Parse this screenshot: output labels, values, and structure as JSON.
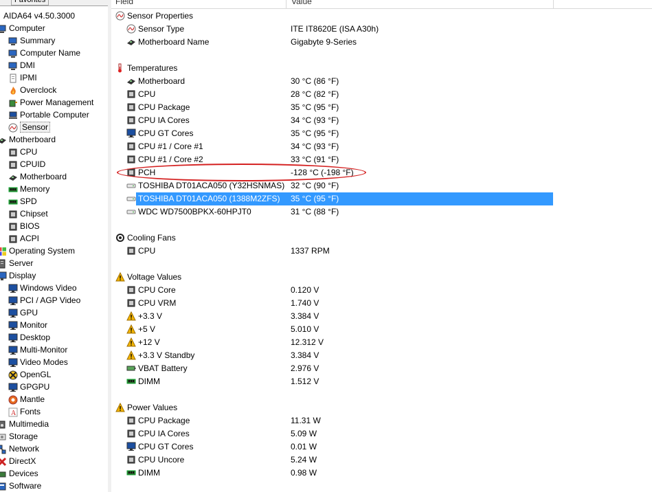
{
  "tabs": {
    "menu": "",
    "favorites": "Favorites"
  },
  "columns": {
    "field": "Field",
    "value": "Value"
  },
  "tree": [
    {
      "label": "AIDA64 v4.50.3000",
      "icon": "aida64-icon",
      "level": 0
    },
    {
      "label": "Computer",
      "icon": "computer-icon",
      "level": 0
    },
    {
      "label": "Summary",
      "icon": "computer-icon",
      "level": 1
    },
    {
      "label": "Computer Name",
      "icon": "computer-icon",
      "level": 1
    },
    {
      "label": "DMI",
      "icon": "computer-icon",
      "level": 1
    },
    {
      "label": "IPMI",
      "icon": "document-icon",
      "level": 1
    },
    {
      "label": "Overclock",
      "icon": "flame-icon",
      "level": 1
    },
    {
      "label": "Power Management",
      "icon": "power-icon",
      "level": 1
    },
    {
      "label": "Portable Computer",
      "icon": "laptop-icon",
      "level": 1
    },
    {
      "label": "Sensor",
      "icon": "sensor-icon",
      "level": 1,
      "selected": true
    },
    {
      "label": "Motherboard",
      "icon": "motherboard-icon",
      "level": 0
    },
    {
      "label": "CPU",
      "icon": "chip-icon",
      "level": 1
    },
    {
      "label": "CPUID",
      "icon": "chip-icon",
      "level": 1
    },
    {
      "label": "Motherboard",
      "icon": "motherboard-icon",
      "level": 1
    },
    {
      "label": "Memory",
      "icon": "memory-icon",
      "level": 1
    },
    {
      "label": "SPD",
      "icon": "memory-icon",
      "level": 1
    },
    {
      "label": "Chipset",
      "icon": "chip-icon",
      "level": 1
    },
    {
      "label": "BIOS",
      "icon": "chip-icon",
      "level": 1
    },
    {
      "label": "ACPI",
      "icon": "chip-icon",
      "level": 1
    },
    {
      "label": "Operating System",
      "icon": "windows-icon",
      "level": 0
    },
    {
      "label": "Server",
      "icon": "server-icon",
      "level": 0
    },
    {
      "label": "Display",
      "icon": "display-icon",
      "level": 0
    },
    {
      "label": "Windows Video",
      "icon": "monitor-icon",
      "level": 1
    },
    {
      "label": "PCI / AGP Video",
      "icon": "monitor-icon",
      "level": 1
    },
    {
      "label": "GPU",
      "icon": "monitor-icon",
      "level": 1
    },
    {
      "label": "Monitor",
      "icon": "monitor-icon",
      "level": 1
    },
    {
      "label": "Desktop",
      "icon": "monitor-icon",
      "level": 1
    },
    {
      "label": "Multi-Monitor",
      "icon": "monitor-icon",
      "level": 1
    },
    {
      "label": "Video Modes",
      "icon": "monitor-icon",
      "level": 1
    },
    {
      "label": "OpenGL",
      "icon": "opengl-icon",
      "level": 1
    },
    {
      "label": "GPGPU",
      "icon": "monitor-icon",
      "level": 1
    },
    {
      "label": "Mantle",
      "icon": "mantle-icon",
      "level": 1
    },
    {
      "label": "Fonts",
      "icon": "font-icon",
      "level": 1
    },
    {
      "label": "Multimedia",
      "icon": "multimedia-icon",
      "level": 0
    },
    {
      "label": "Storage",
      "icon": "storage-icon",
      "level": 0
    },
    {
      "label": "Network",
      "icon": "network-icon",
      "level": 0
    },
    {
      "label": "DirectX",
      "icon": "directx-icon",
      "level": 0
    },
    {
      "label": "Devices",
      "icon": "devices-icon",
      "level": 0
    },
    {
      "label": "Software",
      "icon": "software-icon",
      "level": 0
    }
  ],
  "rows": [
    {
      "type": "group",
      "field": "Sensor Properties",
      "value": "",
      "icon": "sensor-icon"
    },
    {
      "type": "item",
      "field": "Sensor Type",
      "value": "ITE IT8620E  (ISA A30h)",
      "icon": "sensor-icon"
    },
    {
      "type": "item",
      "field": "Motherboard Name",
      "value": "Gigabyte 9-Series",
      "icon": "motherboard-icon"
    },
    {
      "type": "spacer"
    },
    {
      "type": "group",
      "field": "Temperatures",
      "value": "",
      "icon": "thermometer-icon"
    },
    {
      "type": "item",
      "field": "Motherboard",
      "value": "30 °C  (86 °F)",
      "icon": "motherboard-icon"
    },
    {
      "type": "item",
      "field": "CPU",
      "value": "28 °C  (82 °F)",
      "icon": "chip-icon"
    },
    {
      "type": "item",
      "field": "CPU Package",
      "value": "35 °C  (95 °F)",
      "icon": "chip-icon"
    },
    {
      "type": "item",
      "field": "CPU IA Cores",
      "value": "34 °C  (93 °F)",
      "icon": "chip-icon"
    },
    {
      "type": "item",
      "field": "CPU GT Cores",
      "value": "35 °C  (95 °F)",
      "icon": "monitor-icon"
    },
    {
      "type": "item",
      "field": "CPU #1 / Core #1",
      "value": "34 °C  (93 °F)",
      "icon": "chip-icon"
    },
    {
      "type": "item",
      "field": "CPU #1 / Core #2",
      "value": "33 °C  (91 °F)",
      "icon": "chip-icon"
    },
    {
      "type": "item",
      "field": "PCH",
      "value": "-128 °C  (-198 °F)",
      "icon": "chip-icon",
      "circled": true
    },
    {
      "type": "item",
      "field": "TOSHIBA DT01ACA050 (Y32HSNMAS)",
      "value": "32 °C  (90 °F)",
      "icon": "hdd-icon"
    },
    {
      "type": "item",
      "field": "TOSHIBA DT01ACA050 (1388M2ZFS)",
      "value": "35 °C  (95 °F)",
      "icon": "hdd-icon",
      "highlighted": true
    },
    {
      "type": "item",
      "field": "WDC WD7500BPKX-60HPJT0",
      "value": "31 °C  (88 °F)",
      "icon": "hdd-icon"
    },
    {
      "type": "spacer"
    },
    {
      "type": "group",
      "field": "Cooling Fans",
      "value": "",
      "icon": "fan-icon"
    },
    {
      "type": "item",
      "field": "CPU",
      "value": "1337 RPM",
      "icon": "chip-icon"
    },
    {
      "type": "spacer"
    },
    {
      "type": "group",
      "field": "Voltage Values",
      "value": "",
      "icon": "warning-icon"
    },
    {
      "type": "item",
      "field": "CPU Core",
      "value": "0.120 V",
      "icon": "chip-icon"
    },
    {
      "type": "item",
      "field": "CPU VRM",
      "value": "1.740 V",
      "icon": "chip-icon"
    },
    {
      "type": "item",
      "field": "+3.3 V",
      "value": "3.384 V",
      "icon": "warning-icon"
    },
    {
      "type": "item",
      "field": "+5 V",
      "value": "5.010 V",
      "icon": "warning-icon"
    },
    {
      "type": "item",
      "field": "+12 V",
      "value": "12.312 V",
      "icon": "warning-icon"
    },
    {
      "type": "item",
      "field": "+3.3 V Standby",
      "value": "3.384 V",
      "icon": "warning-icon"
    },
    {
      "type": "item",
      "field": "VBAT Battery",
      "value": "2.976 V",
      "icon": "battery-icon"
    },
    {
      "type": "item",
      "field": "DIMM",
      "value": "1.512 V",
      "icon": "memory-icon"
    },
    {
      "type": "spacer"
    },
    {
      "type": "group",
      "field": "Power Values",
      "value": "",
      "icon": "warning-icon"
    },
    {
      "type": "item",
      "field": "CPU Package",
      "value": "11.31 W",
      "icon": "chip-icon"
    },
    {
      "type": "item",
      "field": "CPU IA Cores",
      "value": "5.09 W",
      "icon": "chip-icon"
    },
    {
      "type": "item",
      "field": "CPU GT Cores",
      "value": "0.01 W",
      "icon": "monitor-icon"
    },
    {
      "type": "item",
      "field": "CPU Uncore",
      "value": "5.24 W",
      "icon": "chip-icon"
    },
    {
      "type": "item",
      "field": "DIMM",
      "value": "0.98 W",
      "icon": "memory-icon"
    }
  ],
  "colors": {
    "selection": "#3399ff",
    "annotation": "#d42020",
    "warning": "#f2b400"
  }
}
